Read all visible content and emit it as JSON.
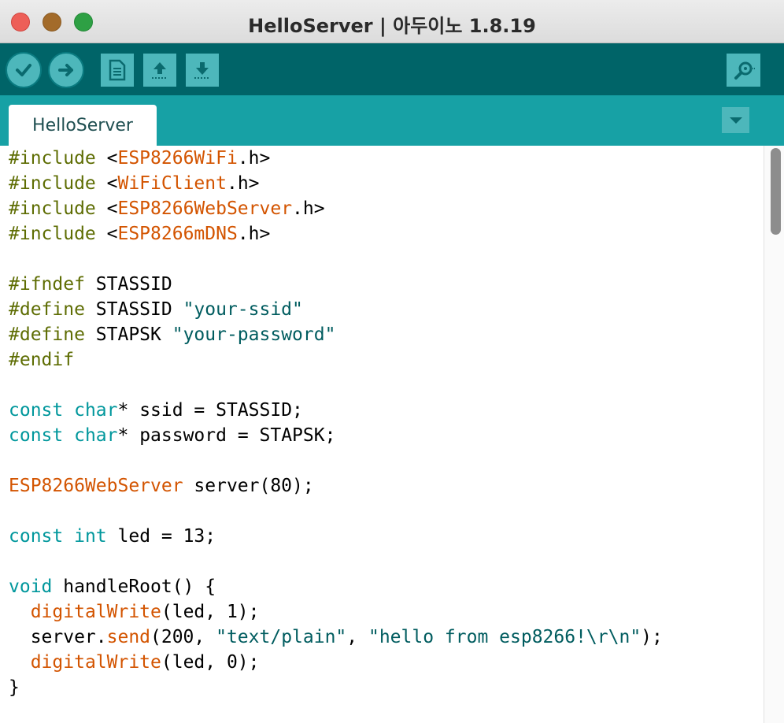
{
  "window": {
    "title": "HelloServer | 아두이노 1.8.19"
  },
  "toolbar": {
    "verify_icon": "checkmark-icon",
    "upload_icon": "arrow-right-icon",
    "new_icon": "new-file-icon",
    "open_icon": "open-upload-icon",
    "save_icon": "save-download-icon",
    "serial_monitor_icon": "magnifier-icon"
  },
  "tabs": [
    {
      "label": "HelloServer"
    }
  ],
  "colors": {
    "toolbar_bg": "#006468",
    "tabbar_bg": "#17a1a5",
    "button_bg": "#4db7bb",
    "preprocessor": "#5e6d03",
    "type_keyword": "#00979c",
    "library_identifier": "#d35400",
    "string": "#005c5f"
  },
  "code_lines": [
    [
      {
        "t": "#include",
        "c": "kw-pp"
      },
      {
        "t": " <"
      },
      {
        "t": "ESP8266WiFi",
        "c": "kw-lib"
      },
      {
        "t": ".h>"
      }
    ],
    [
      {
        "t": "#include",
        "c": "kw-pp"
      },
      {
        "t": " <"
      },
      {
        "t": "WiFiClient",
        "c": "kw-lib"
      },
      {
        "t": ".h>"
      }
    ],
    [
      {
        "t": "#include",
        "c": "kw-pp"
      },
      {
        "t": " <"
      },
      {
        "t": "ESP8266WebServer",
        "c": "kw-lib"
      },
      {
        "t": ".h>"
      }
    ],
    [
      {
        "t": "#include",
        "c": "kw-pp"
      },
      {
        "t": " <"
      },
      {
        "t": "ESP8266mDNS",
        "c": "kw-lib"
      },
      {
        "t": ".h>"
      }
    ],
    [],
    [
      {
        "t": "#ifndef",
        "c": "kw-pp"
      },
      {
        "t": " STASSID"
      }
    ],
    [
      {
        "t": "#define",
        "c": "kw-pp"
      },
      {
        "t": " STASSID "
      },
      {
        "t": "\"your-ssid\"",
        "c": "str"
      }
    ],
    [
      {
        "t": "#define",
        "c": "kw-pp"
      },
      {
        "t": " STAPSK "
      },
      {
        "t": "\"your-password\"",
        "c": "str"
      }
    ],
    [
      {
        "t": "#endif",
        "c": "kw-pp"
      }
    ],
    [],
    [
      {
        "t": "const",
        "c": "kw-type"
      },
      {
        "t": " "
      },
      {
        "t": "char",
        "c": "kw-type"
      },
      {
        "t": "* ssid = STASSID;"
      }
    ],
    [
      {
        "t": "const",
        "c": "kw-type"
      },
      {
        "t": " "
      },
      {
        "t": "char",
        "c": "kw-type"
      },
      {
        "t": "* password = STAPSK;"
      }
    ],
    [],
    [
      {
        "t": "ESP8266WebServer",
        "c": "kw-lib"
      },
      {
        "t": " server(80);"
      }
    ],
    [],
    [
      {
        "t": "const",
        "c": "kw-type"
      },
      {
        "t": " "
      },
      {
        "t": "int",
        "c": "kw-type"
      },
      {
        "t": " led = 13;"
      }
    ],
    [],
    [
      {
        "t": "void",
        "c": "kw-type"
      },
      {
        "t": " handleRoot() {"
      }
    ],
    [
      {
        "t": "  "
      },
      {
        "t": "digitalWrite",
        "c": "kw-lib"
      },
      {
        "t": "(led, 1);"
      }
    ],
    [
      {
        "t": "  server."
      },
      {
        "t": "send",
        "c": "kw-lib"
      },
      {
        "t": "(200, "
      },
      {
        "t": "\"text/plain\"",
        "c": "str"
      },
      {
        "t": ", "
      },
      {
        "t": "\"hello from esp8266!\\r\\n\"",
        "c": "str"
      },
      {
        "t": ");"
      }
    ],
    [
      {
        "t": "  "
      },
      {
        "t": "digitalWrite",
        "c": "kw-lib"
      },
      {
        "t": "(led, 0);"
      }
    ],
    [
      {
        "t": "}"
      }
    ]
  ]
}
